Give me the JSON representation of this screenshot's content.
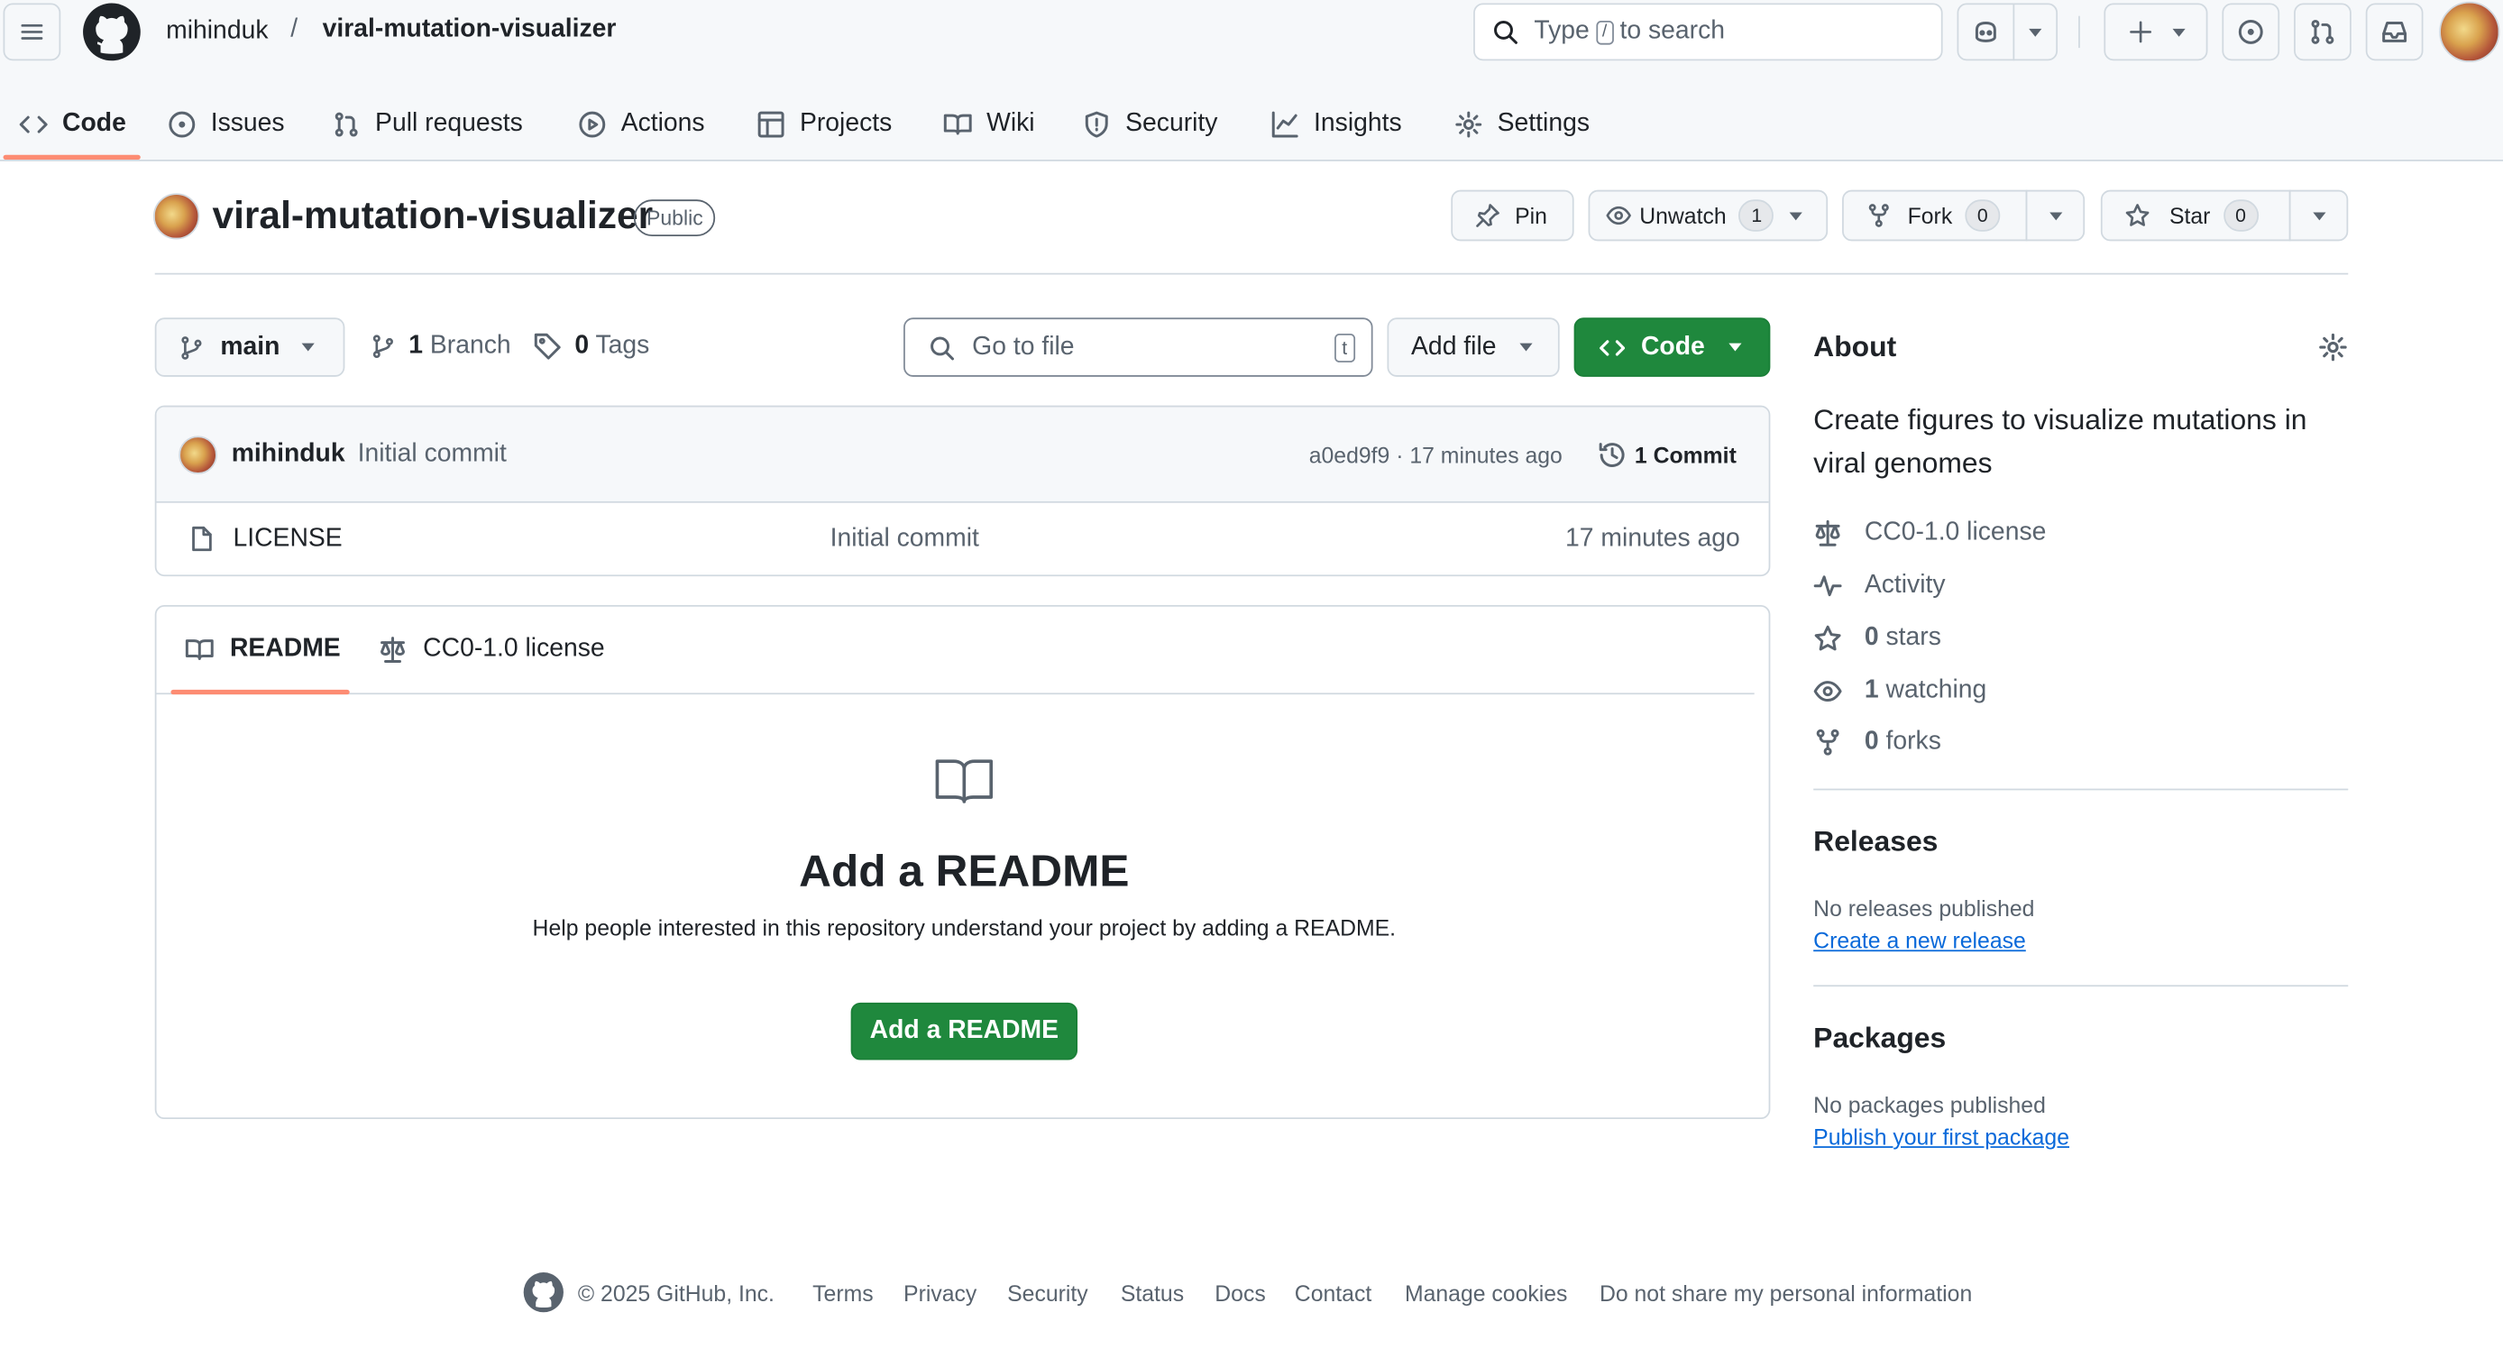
{
  "header": {
    "owner": "mihinduk",
    "separator": "/",
    "repo": "viral-mutation-visualizer",
    "search_type": "Type",
    "search_key": "/",
    "search_rest": "to search"
  },
  "nav_tabs": [
    {
      "label": "Code",
      "icon": "code-icon"
    },
    {
      "label": "Issues",
      "icon": "issue-icon"
    },
    {
      "label": "Pull requests",
      "icon": "pull-request-icon"
    },
    {
      "label": "Actions",
      "icon": "play-icon"
    },
    {
      "label": "Projects",
      "icon": "table-icon"
    },
    {
      "label": "Wiki",
      "icon": "book-icon"
    },
    {
      "label": "Security",
      "icon": "shield-icon"
    },
    {
      "label": "Insights",
      "icon": "graph-icon"
    },
    {
      "label": "Settings",
      "icon": "gear-icon"
    }
  ],
  "repo_header": {
    "title": "viral-mutation-visualizer",
    "visibility": "Public",
    "pin": "Pin",
    "unwatch": "Unwatch",
    "watch_count": "1",
    "fork": "Fork",
    "fork_count": "0",
    "star": "Star",
    "star_count": "0"
  },
  "toolbar": {
    "branch": "main",
    "branch_count": "1",
    "branch_label": "Branch",
    "tag_count": "0",
    "tag_label": "Tags",
    "goto_placeholder": "Go to file",
    "goto_key": "t",
    "add_file": "Add file",
    "code": "Code"
  },
  "commit": {
    "author": "mihinduk",
    "message": "Initial commit",
    "hash_time": "a0ed9f9 · 17 minutes ago",
    "count_label": "1 Commit"
  },
  "files": [
    {
      "name": "LICENSE",
      "message": "Initial commit",
      "time": "17 minutes ago"
    }
  ],
  "readme": {
    "tab_readme": "README",
    "tab_license": "CC0-1.0 license",
    "heading": "Add a README",
    "description": "Help people interested in this repository understand your project by adding a README.",
    "button": "Add a README"
  },
  "about": {
    "heading": "About",
    "description": "Create figures to visualize mutations in viral genomes",
    "license": "CC0-1.0 license",
    "activity": "Activity",
    "stars_count": "0",
    "stars_label": "stars",
    "watching_count": "1",
    "watching_label": "watching",
    "forks_count": "0",
    "forks_label": "forks"
  },
  "releases": {
    "heading": "Releases",
    "none": "No releases published",
    "link": "Create a new release"
  },
  "packages": {
    "heading": "Packages",
    "none": "No packages published",
    "link": "Publish your first package"
  },
  "footer": {
    "copyright": "© 2025 GitHub, Inc.",
    "links": [
      "Terms",
      "Privacy",
      "Security",
      "Status",
      "Docs",
      "Contact",
      "Manage cookies",
      "Do not share my personal information"
    ]
  },
  "colors": {
    "green": "#1f883d",
    "accent_underline": "#fd8c73",
    "link": "#0969da"
  }
}
